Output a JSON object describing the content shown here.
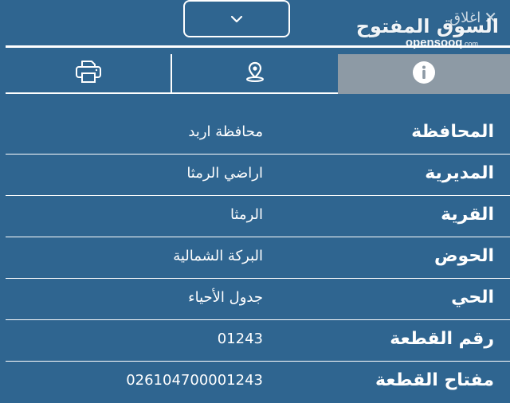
{
  "header": {
    "toggle_icon": "chevron-down-icon",
    "close_label": "اغلاق",
    "close_icon": "close-x-icon"
  },
  "watermark": {
    "arabic": "السوق المفتوح",
    "latin": "opensooq",
    "latin_suffix": ".com"
  },
  "tabs": [
    {
      "id": "print",
      "icon": "printer-icon"
    },
    {
      "id": "location",
      "icon": "map-pin-icon"
    },
    {
      "id": "info",
      "icon": "info-icon",
      "active": true
    }
  ],
  "colors": {
    "background": "#2f6590",
    "active_tab": "#8d9aa5",
    "text": "#ffffff"
  },
  "details": {
    "rows": [
      {
        "label": "المحافظة",
        "value": "محافظة اربد"
      },
      {
        "label": "المديرية",
        "value": "اراضي الرمثا"
      },
      {
        "label": "القرية",
        "value": "الرمثا"
      },
      {
        "label": "الحوض",
        "value": "البركة الشمالية"
      },
      {
        "label": "الحي",
        "value": "جدول الأحياء"
      },
      {
        "label": "رقم القطعة",
        "value": "01243"
      },
      {
        "label": "مفتاح القطعة",
        "value": "026104700001243"
      }
    ]
  }
}
